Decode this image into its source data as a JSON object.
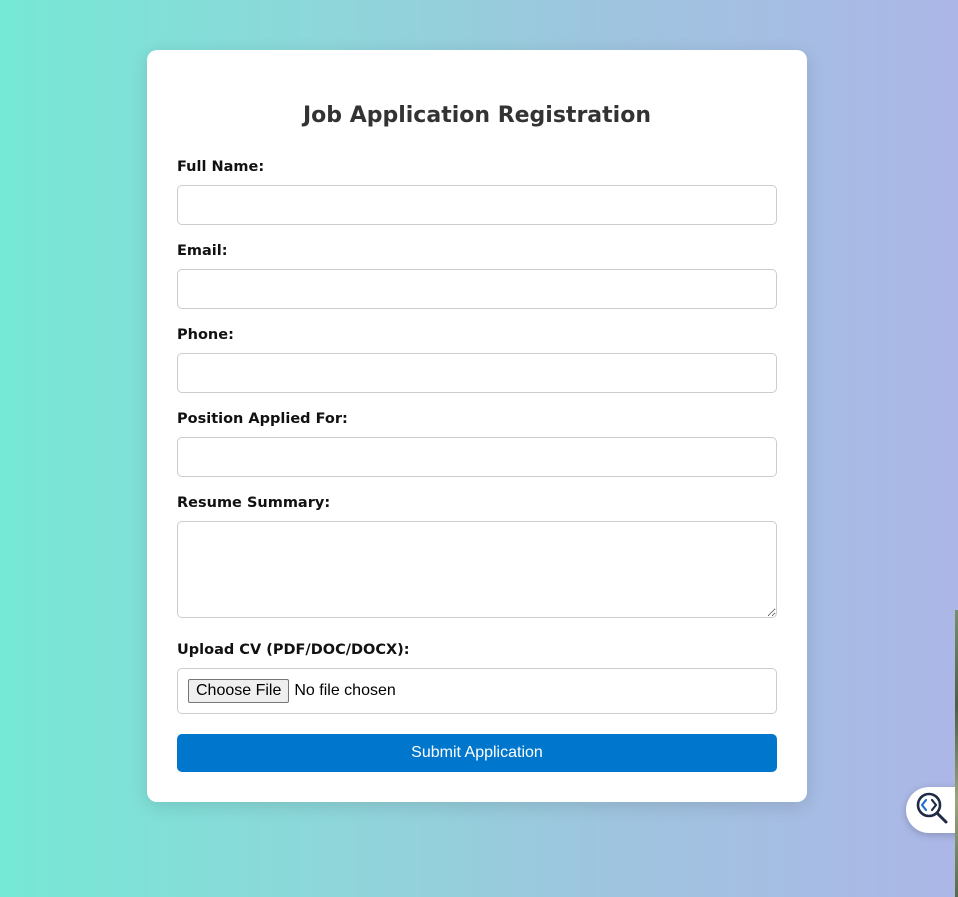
{
  "form": {
    "title": "Job Application Registration",
    "fields": {
      "full_name": {
        "label": "Full Name:",
        "value": "",
        "placeholder": ""
      },
      "email": {
        "label": "Email:",
        "value": "",
        "placeholder": ""
      },
      "phone": {
        "label": "Phone:",
        "value": "",
        "placeholder": ""
      },
      "position": {
        "label": "Position Applied For:",
        "value": "",
        "placeholder": ""
      },
      "resume_summary": {
        "label": "Resume Summary:",
        "value": "",
        "placeholder": ""
      },
      "cv_upload": {
        "label": "Upload CV (PDF/DOC/DOCX):",
        "button_label": "Choose File",
        "status": "No file chosen"
      }
    },
    "submit_label": "Submit Application"
  },
  "colors": {
    "background_start": "#76e8d6",
    "background_end": "#acb6e7",
    "card": "#ffffff",
    "submit_button": "#0077cc",
    "title_text": "#333333"
  },
  "widgets": {
    "inspect_button_icon": "magnifier-code-icon"
  }
}
